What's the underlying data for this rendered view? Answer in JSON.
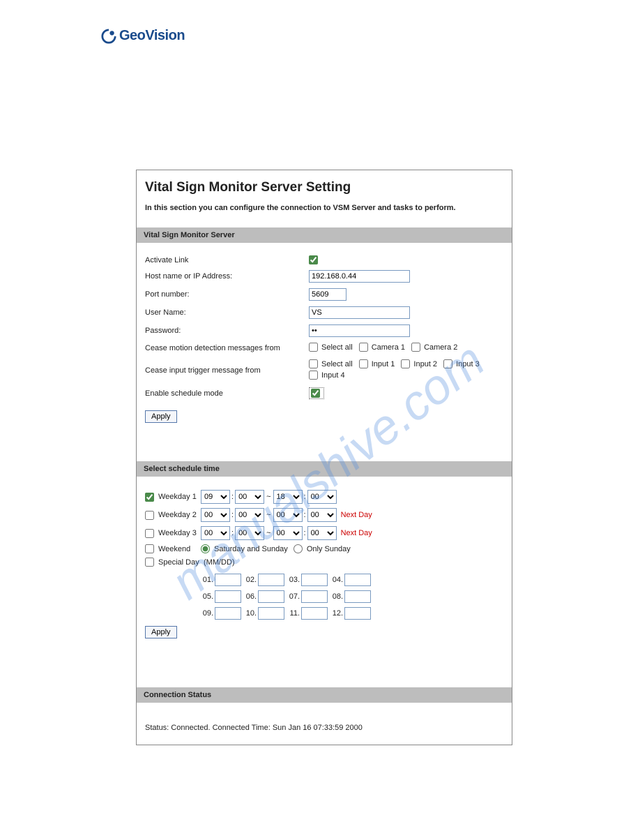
{
  "brand": {
    "name": "GeoVision"
  },
  "title": "Vital Sign Monitor Server Setting",
  "subtitle": "In this section you can configure the connection to VSM Server and tasks to perform.",
  "sections": {
    "server": "Vital Sign Monitor Server",
    "schedule": "Select schedule time",
    "connection": "Connection Status"
  },
  "server": {
    "activate_label": "Activate Link",
    "host_label": "Host name or IP Address:",
    "host_value": "192.168.0.44",
    "port_label": "Port number:",
    "port_value": "5609",
    "user_label": "User Name:",
    "user_value": "VS",
    "pass_label": "Password:",
    "pass_value": "••",
    "cease_motion_label": "Cease motion detection messages from",
    "cease_input_label": "Cease input trigger message from",
    "enable_schedule_label": "Enable schedule mode",
    "select_all": "Select all",
    "camera1": "Camera 1",
    "camera2": "Camera 2",
    "input1": "Input 1",
    "input2": "Input 2",
    "input3": "Input 3",
    "input4": "Input 4"
  },
  "buttons": {
    "apply": "Apply"
  },
  "schedule": {
    "weekday1": "Weekday 1",
    "weekday2": "Weekday 2",
    "weekday3": "Weekday 3",
    "weekend": "Weekend",
    "special": "Special Day",
    "mmdd": "(MM/DD)",
    "sat_sun": "Saturday and Sunday",
    "only_sun": "Only Sunday",
    "next_day": "Next Day",
    "w1": {
      "h1": "09",
      "m1": "00",
      "h2": "18",
      "m2": "00"
    },
    "w2": {
      "h1": "00",
      "m1": "00",
      "h2": "00",
      "m2": "00"
    },
    "w3": {
      "h1": "00",
      "m1": "00",
      "h2": "00",
      "m2": "00"
    },
    "sp": [
      "01.",
      "02.",
      "03.",
      "04.",
      "05.",
      "06.",
      "07.",
      "08.",
      "09.",
      "10.",
      "11.",
      "12."
    ]
  },
  "status": {
    "text": "Status: Connected. Connected Time: Sun Jan 16 07:33:59 2000"
  },
  "watermark": "manualshive.com"
}
